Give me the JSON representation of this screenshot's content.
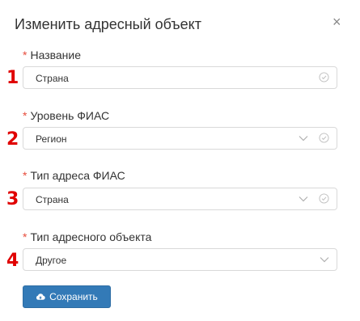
{
  "modal": {
    "title": "Изменить адресный объект",
    "close_icon": "×"
  },
  "form": {
    "required_marker": "*",
    "fields": [
      {
        "marker": "1",
        "label": "Название",
        "value": "Страна",
        "type": "text"
      },
      {
        "marker": "2",
        "label": "Уровень ФИАС",
        "value": "Регион",
        "type": "select"
      },
      {
        "marker": "3",
        "label": "Тип адреса ФИАС",
        "value": "Страна",
        "type": "select"
      },
      {
        "marker": "4",
        "label": "Тип адресного объекта",
        "value": "Другое",
        "type": "select"
      }
    ],
    "save_label": "Сохранить"
  },
  "colors": {
    "required": "#e74c3c",
    "marker": "#e00000",
    "primary_button": "#337ab7"
  }
}
